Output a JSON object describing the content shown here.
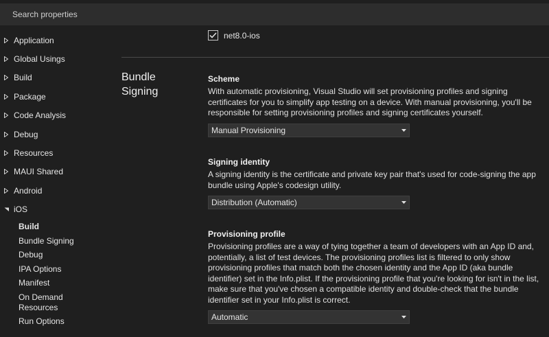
{
  "search": {
    "placeholder": "Search properties"
  },
  "sidebar": {
    "items": [
      {
        "label": "Application",
        "expanded": false
      },
      {
        "label": "Global Usings",
        "expanded": false
      },
      {
        "label": "Build",
        "expanded": false
      },
      {
        "label": "Package",
        "expanded": false
      },
      {
        "label": "Code Analysis",
        "expanded": false
      },
      {
        "label": "Debug",
        "expanded": false
      },
      {
        "label": "Resources",
        "expanded": false
      },
      {
        "label": "MAUI Shared",
        "expanded": false
      },
      {
        "label": "Android",
        "expanded": false
      },
      {
        "label": "iOS",
        "expanded": true
      }
    ],
    "ios_children": [
      {
        "label": "Build",
        "selected": true
      },
      {
        "label": "Bundle Signing"
      },
      {
        "label": "Debug"
      },
      {
        "label": "IPA Options"
      },
      {
        "label": "Manifest"
      },
      {
        "label": "On Demand Resources"
      },
      {
        "label": "Run Options"
      }
    ]
  },
  "top_checkbox": {
    "label": "net8.0-ios",
    "checked": true
  },
  "section": {
    "title_line1": "Bundle",
    "title_line2": "Signing"
  },
  "scheme": {
    "title": "Scheme",
    "description": "With automatic provisioning, Visual Studio will set provisioning profiles and signing certificates for you to simplify app testing on a device. With manual provisioning, you'll be responsible for setting provisioning profiles and signing certificates yourself.",
    "value": "Manual Provisioning"
  },
  "signing_identity": {
    "title": "Signing identity",
    "description": "A signing identity is the certificate and private key pair that's used for code-signing the app bundle using Apple's codesign utility.",
    "value": "Distribution (Automatic)"
  },
  "provisioning_profile": {
    "title": "Provisioning profile",
    "description": "Provisioning profiles are a way of tying together a team of developers with an App ID and, potentially, a list of test devices. The provisioning profiles list is filtered to only show provisioning profiles that match both the chosen identity and the App ID (aka bundle identifier) set in the Info.plist. If the provisioning profile that you're looking for isn't in the list, make sure that you've chosen a compatible identity and double-check that the bundle identifier set in your Info.plist is correct.",
    "value": "Automatic"
  }
}
